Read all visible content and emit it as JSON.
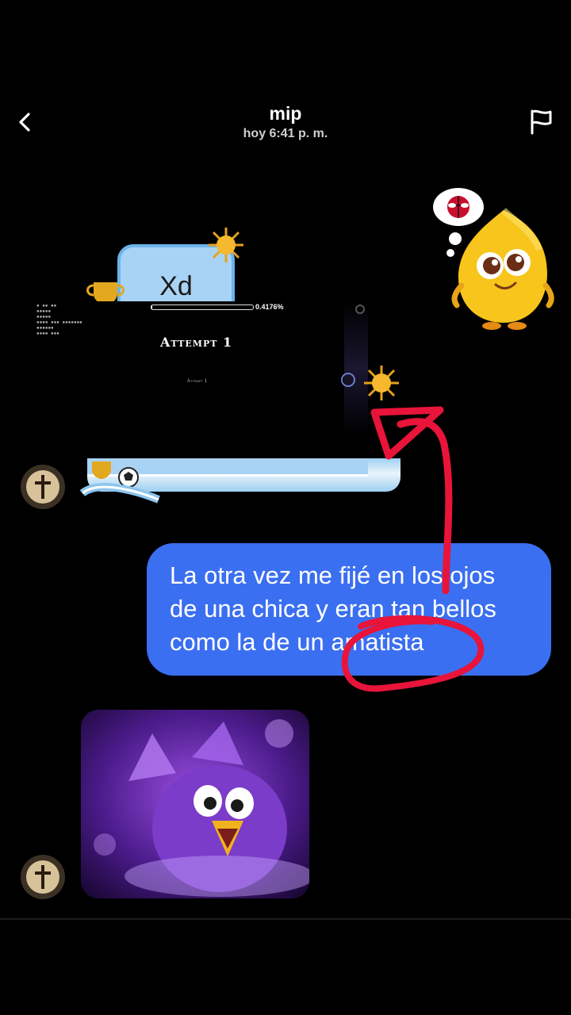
{
  "header": {
    "title": "mip",
    "subtitle": "hoy 6:41 p. m."
  },
  "messages": {
    "received_xd": "Xd",
    "sent_text": "La otra vez me fijé en los ojos de una chica y eran tan bellos como la de un amatista"
  },
  "game_overlay": {
    "progress_text": "0.4176%",
    "progress_value": 0.004176,
    "attempt_title": "Attempt 1",
    "attempt_small": "Attempt 1"
  },
  "icons": {
    "back": "chevron-left-icon",
    "report": "flag-icon",
    "avatar": "cross-avatar"
  },
  "colors": {
    "background": "#000000",
    "sent_bubble": "#3b6ff1",
    "received_bubble": "#a9d3f5",
    "annotation": "#e8143a"
  }
}
